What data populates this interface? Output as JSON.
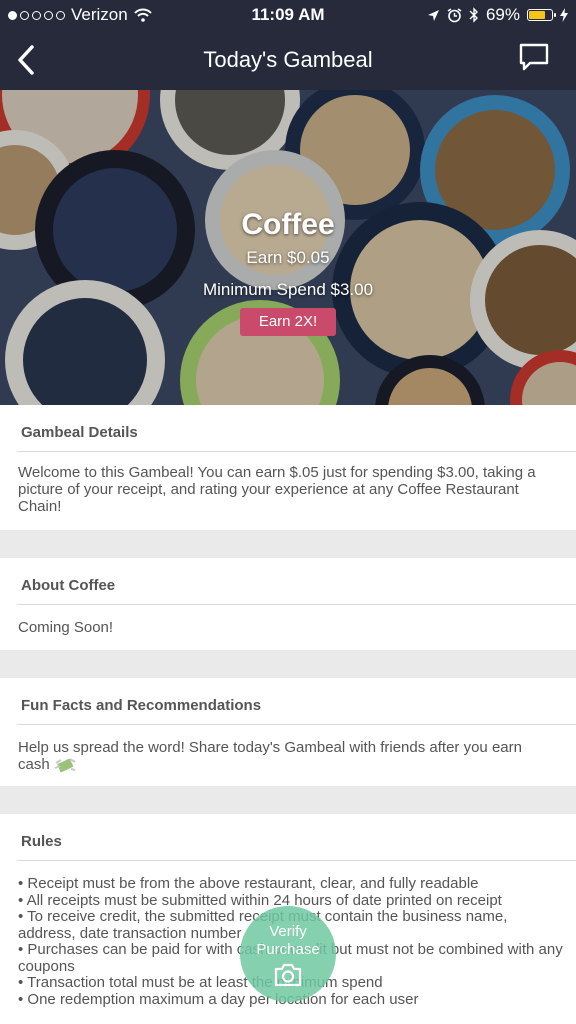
{
  "status_bar": {
    "carrier": "Verizon",
    "time": "11:09 AM",
    "battery_percent": "69%",
    "signal_icon": "signal-dots-icon",
    "wifi_icon": "wifi-icon",
    "location_icon": "location-arrow-icon",
    "alarm_icon": "alarm-icon",
    "bluetooth_icon": "bluetooth-icon",
    "battery_icon": "battery-icon",
    "battery_color": "#f5c518"
  },
  "nav": {
    "title": "Today's Gambeal",
    "back_icon": "back-chevron-icon",
    "chat_icon": "chat-bubble-icon",
    "bar_color": "#262a3b"
  },
  "hero": {
    "title": "Coffee",
    "earn": "Earn $0.05",
    "minimum_spend": "Minimum Spend $3.00",
    "badge": "Earn 2X!",
    "badge_color": "#c94a6a"
  },
  "sections": {
    "details": {
      "heading": "Gambeal Details",
      "body": "Welcome to this Gambeal! You can earn $.05 just for spending $3.00, taking a picture of your receipt, and rating your experience at any Coffee Restaurant Chain!"
    },
    "about": {
      "heading": "About Coffee",
      "body": "Coming Soon!"
    },
    "fun_facts": {
      "heading": "Fun Facts and Recommendations",
      "body": "Help us spread the word! Share today's Gambeal with friends after you earn cash",
      "emoji_icon": "money-with-wings-icon"
    },
    "rules": {
      "heading": "Rules",
      "items": [
        "• Receipt must be from the above restaurant, clear, and fully readable",
        "• All receipts must be submitted within 24 hours of date printed on receipt",
        "• To receive credit, the submitted receipt must contain the business name, address, date transaction number",
        "• Purchases can be paid for with cash or credit but must not be combined with any coupons",
        "• Transaction total must be at least the minimum spend",
        "• One redemption maximum a day per location for each user"
      ]
    }
  },
  "fab": {
    "line1": "Verify",
    "line2": "Purchase",
    "icon": "camera-icon",
    "color": "#70c8a0"
  }
}
